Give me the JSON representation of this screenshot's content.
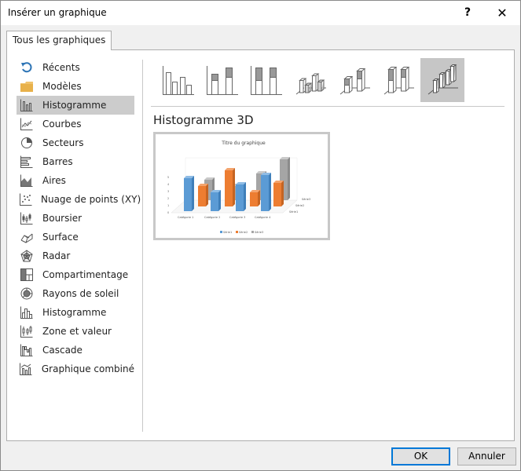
{
  "window": {
    "title": "Insérer un graphique",
    "help_glyph": "?",
    "close_glyph": "✕"
  },
  "tabs": [
    {
      "label": "Tous les graphiques",
      "selected": true
    }
  ],
  "sidebar": {
    "items": [
      {
        "label": "Récents",
        "icon": "undo-arrow-icon"
      },
      {
        "label": "Modèles",
        "icon": "folder-icon"
      },
      {
        "label": "Histogramme",
        "icon": "column-chart-icon",
        "selected": true
      },
      {
        "label": "Courbes",
        "icon": "line-chart-icon"
      },
      {
        "label": "Secteurs",
        "icon": "pie-chart-icon"
      },
      {
        "label": "Barres",
        "icon": "bar-chart-icon"
      },
      {
        "label": "Aires",
        "icon": "area-chart-icon"
      },
      {
        "label": "Nuage de points (XY)",
        "icon": "scatter-chart-icon"
      },
      {
        "label": "Boursier",
        "icon": "stock-chart-icon"
      },
      {
        "label": "Surface",
        "icon": "surface-chart-icon"
      },
      {
        "label": "Radar",
        "icon": "radar-chart-icon"
      },
      {
        "label": "Compartimentage",
        "icon": "treemap-chart-icon"
      },
      {
        "label": "Rayons de soleil",
        "icon": "sunburst-chart-icon"
      },
      {
        "label": "Histogramme",
        "icon": "histogram-chart-icon"
      },
      {
        "label": "Zone et valeur",
        "icon": "box-whisker-chart-icon"
      },
      {
        "label": "Cascade",
        "icon": "waterfall-chart-icon"
      },
      {
        "label": "Graphique combiné",
        "icon": "combo-chart-icon"
      }
    ]
  },
  "subtypes": [
    {
      "name": "clustered-column",
      "selected": false
    },
    {
      "name": "stacked-column",
      "selected": false
    },
    {
      "name": "100-stacked-column",
      "selected": false
    },
    {
      "name": "3d-clustered-column",
      "selected": false
    },
    {
      "name": "3d-stacked-column",
      "selected": false
    },
    {
      "name": "3d-100-stacked-column",
      "selected": false
    },
    {
      "name": "3d-column",
      "selected": true
    }
  ],
  "main": {
    "section_title": "Histogramme 3D",
    "preview": {
      "title": "Titre du graphique",
      "categories": [
        "Catégorie 1",
        "Catégorie 2",
        "Catégorie 3",
        "Catégorie 4"
      ],
      "series_names": [
        "Série1",
        "Série2",
        "Série3"
      ],
      "axis_ticks": [
        "0",
        "1",
        "2",
        "3",
        "4",
        "5"
      ],
      "colors": {
        "Série1": "#5b9bd5",
        "Série2": "#ed7d31",
        "Série3": "#a5a5a5"
      }
    }
  },
  "footer": {
    "ok_label": "OK",
    "cancel_label": "Annuler"
  },
  "colors": {
    "selected_bg": "#cccccc",
    "accent": "#0078d7"
  }
}
